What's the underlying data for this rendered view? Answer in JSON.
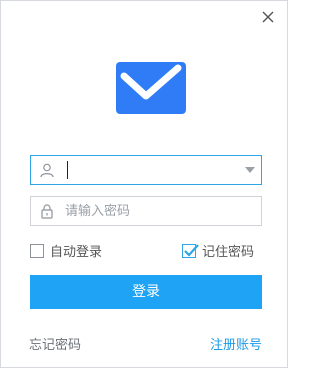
{
  "window": {
    "close_icon": "close-icon"
  },
  "logo": {
    "icon": "mail-envelope-icon",
    "color": "#2f7cf6",
    "accent": "#ffffff"
  },
  "username": {
    "value": "",
    "icon": "user-icon"
  },
  "password": {
    "value": "",
    "placeholder": "请输入密码",
    "icon": "lock-icon"
  },
  "options": {
    "auto_login_label": "自动登录",
    "auto_login_checked": false,
    "remember_password_label": "记住密码",
    "remember_password_checked": true
  },
  "login_button": {
    "label": "登录",
    "color": "#1fa3f4"
  },
  "links": {
    "forgot_password": "忘记密码",
    "register": "注册账号"
  }
}
